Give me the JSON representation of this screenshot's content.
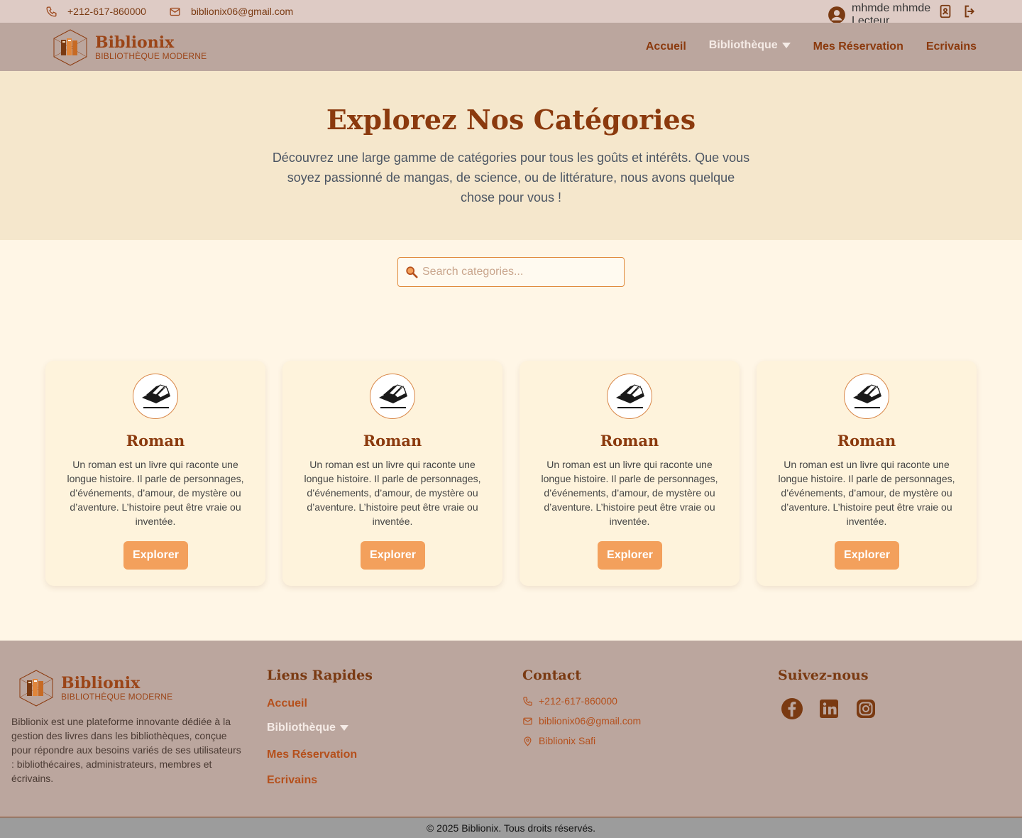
{
  "topbar": {
    "phone": "+212-617-860000",
    "email": "biblionix06@gmail.com",
    "user_name": "mhmde mhmde",
    "user_role": "Lecteur"
  },
  "brand": {
    "name": "Biblionix",
    "tagline": "BIBLIOTHÈQUE MODERNE"
  },
  "nav": {
    "items": [
      {
        "label": "Accueil"
      },
      {
        "label": "Bibliothèque"
      },
      {
        "label": "Mes Réservation"
      },
      {
        "label": "Ecrivains"
      }
    ]
  },
  "hero": {
    "title": "Explorez Nos Catégories",
    "subtitle": "Découvrez une large gamme de catégories pour tous les goûts et intérêts. Que vous soyez passionné de mangas, de science, ou de littérature, nous avons quelque chose pour vous !"
  },
  "search": {
    "placeholder": "Search categories..."
  },
  "categories": [
    {
      "title": "Roman",
      "description": "Un roman est un livre qui raconte une longue histoire. Il parle de personnages, d’événements, d’amour, de mystère ou d’aventure. L’histoire peut être vraie ou inventée.",
      "button": "Explorer"
    },
    {
      "title": "Roman",
      "description": "Un roman est un livre qui raconte une longue histoire. Il parle de personnages, d’événements, d’amour, de mystère ou d’aventure. L’histoire peut être vraie ou inventée.",
      "button": "Explorer"
    },
    {
      "title": "Roman",
      "description": "Un roman est un livre qui raconte une longue histoire. Il parle de personnages, d’événements, d’amour, de mystère ou d’aventure. L’histoire peut être vraie ou inventée.",
      "button": "Explorer"
    },
    {
      "title": "Roman",
      "description": "Un roman est un livre qui raconte une longue histoire. Il parle de personnages, d’événements, d’amour, de mystère ou d’aventure. L’histoire peut être vraie ou inventée.",
      "button": "Explorer"
    }
  ],
  "footer": {
    "about": "Biblionix est une plateforme innovante dédiée à la gestion des livres dans les bibliothèques, conçue pour répondre aux besoins variés de ses utilisateurs : bibliothécaires, administrateurs, membres et écrivains.",
    "links_title": "Liens Rapides",
    "links": [
      {
        "label": "Accueil"
      },
      {
        "label": "Bibliothèque"
      },
      {
        "label": "Mes Réservation"
      },
      {
        "label": "Ecrivains"
      }
    ],
    "contact_title": "Contact",
    "contact": {
      "phone": "+212-617-860000",
      "email": "biblionix06@gmail.com",
      "address": "Biblionix Safi"
    },
    "social_title": "Suivez-nous",
    "copyright": "© 2025 Biblionix. Tous droits réservés."
  },
  "colors": {
    "accent": "#8b3a0e",
    "button": "#f3a05c",
    "nav_bg": "#bba69e",
    "topbar_bg": "#decbc5",
    "hero_bg": "#f5e7cc",
    "page_bg": "#fff6e6"
  },
  "icons": [
    "phone-icon",
    "mail-icon",
    "user-avatar-icon",
    "id-card-icon",
    "logout-icon",
    "search-icon",
    "book-icon",
    "location-icon",
    "facebook-icon",
    "linkedin-icon",
    "instagram-icon"
  ]
}
